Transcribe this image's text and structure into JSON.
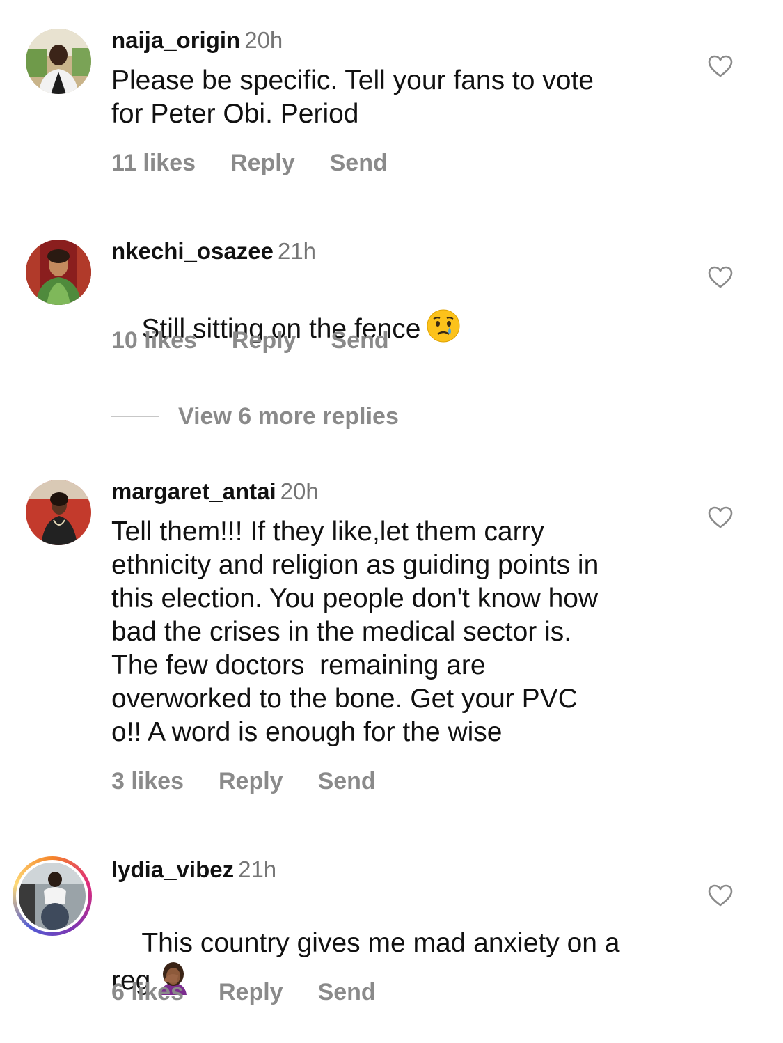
{
  "comments": [
    {
      "username": "naija_origin",
      "time": "20h",
      "text": "Please be specific. Tell your fans to vote\nfor Peter Obi. Period",
      "likes": "11 likes",
      "reply": "Reply",
      "send": "Send"
    },
    {
      "username": "nkechi_osazee",
      "time": "21h",
      "text": "Still sitting on the fence",
      "emoji": "crying-face-emoji",
      "likes": "10 likes",
      "reply": "Reply",
      "send": "Send"
    },
    {
      "username": "margaret_antai",
      "time": "20h",
      "text": "Tell them!!! If they like,let them carry\nethnicity and religion as guiding points in\nthis election. You people don't know how\nbad the crises in the medical sector is.\nThe few doctors  remaining are\noverworked to the bone. Get your PVC\no!! A word is enough for the wise",
      "likes": "3 likes",
      "reply": "Reply",
      "send": "Send"
    },
    {
      "username": "lydia_vibez",
      "time": "21h",
      "text": "This country gives me mad anxiety on a\nreg",
      "emoji": "woman-facepalming-emoji",
      "likes": "6 likes",
      "reply": "Reply",
      "send": "Send"
    }
  ],
  "view_more_replies": "View 6 more replies",
  "icons": {
    "like": "heart-outline-icon"
  },
  "colors": {
    "text_primary": "#111111",
    "text_secondary": "#8a8a8a",
    "timestamp": "#757575"
  }
}
